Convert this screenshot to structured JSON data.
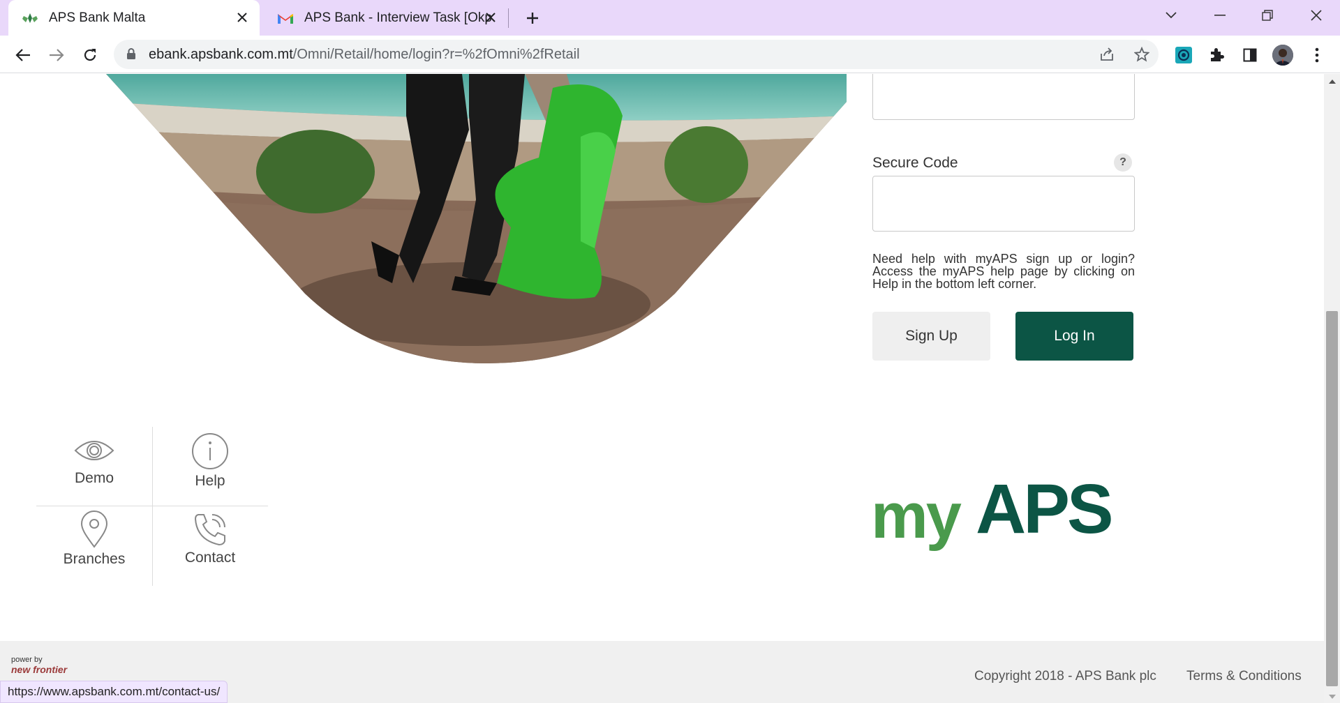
{
  "browser": {
    "tabs": [
      {
        "title": "APS Bank Malta",
        "active": true
      },
      {
        "title": "APS Bank - Interview Task [Okpala",
        "active": false
      }
    ],
    "url_domain": "ebank.apsbank.com.mt",
    "url_path": "/Omni/Retail/home/login?r=%2fOmni%2fRetail",
    "status_url": "https://www.apsbank.com.mt/contact-us/"
  },
  "login": {
    "secure_code_label": "Secure Code",
    "help_icon": "?",
    "help_text": "Need help with myAPS sign up or login? Access the myAPS help page by clicking on Help in the bottom left corner.",
    "signup_label": "Sign Up",
    "login_label": "Log In"
  },
  "quick_links": {
    "demo": "Demo",
    "help": "Help",
    "branches": "Branches",
    "contact": "Contact"
  },
  "logo": {
    "my": "my",
    "aps": "APS"
  },
  "footer": {
    "powered_by": "power by",
    "vendor": "new frontier",
    "copyright": "Copyright 2018 - APS Bank plc",
    "terms": "Terms & Conditions"
  },
  "colors": {
    "brand_dark": "#0c5545",
    "brand_light": "#4a9a4c",
    "tab_strip": "#e9d8fa"
  }
}
